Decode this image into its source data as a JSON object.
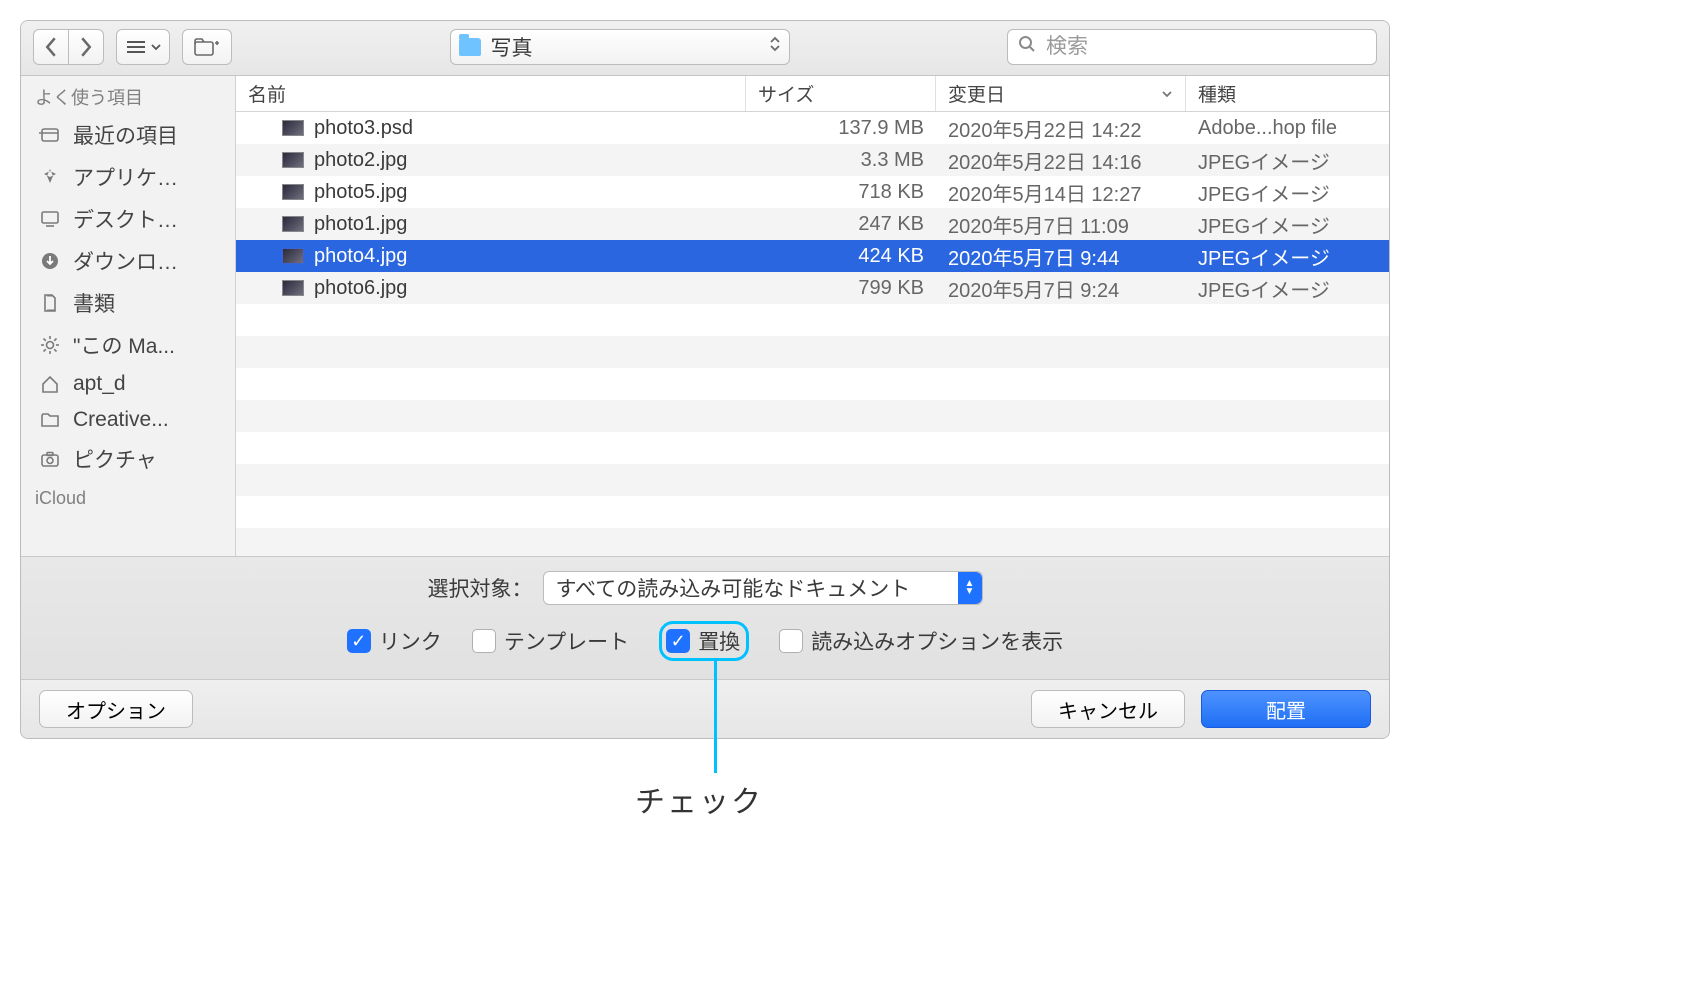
{
  "toolbar": {
    "location_label": "写真",
    "search_placeholder": "検索"
  },
  "sidebar": {
    "group1": "よく使う項目",
    "group2": "iCloud",
    "items": [
      {
        "icon": "recent",
        "label": "最近の項目"
      },
      {
        "icon": "apps",
        "label": "アプリケ…"
      },
      {
        "icon": "desktop",
        "label": "デスクト…"
      },
      {
        "icon": "download",
        "label": "ダウンロ…"
      },
      {
        "icon": "docs",
        "label": "書類"
      },
      {
        "icon": "gear",
        "label": "\"この Ma..."
      },
      {
        "icon": "home",
        "label": "apt_d"
      },
      {
        "icon": "folder",
        "label": "Creative..."
      },
      {
        "icon": "camera",
        "label": "ピクチャ"
      }
    ]
  },
  "columns": {
    "name": "名前",
    "size": "サイズ",
    "modified": "変更日",
    "kind": "種類"
  },
  "files": [
    {
      "name": "photo3.psd",
      "size": "137.9 MB",
      "date": "2020年5月22日 14:22",
      "kind": "Adobe...hop file",
      "selected": false
    },
    {
      "name": "photo2.jpg",
      "size": "3.3 MB",
      "date": "2020年5月22日 14:16",
      "kind": "JPEGイメージ",
      "selected": false
    },
    {
      "name": "photo5.jpg",
      "size": "718 KB",
      "date": "2020年5月14日 12:27",
      "kind": "JPEGイメージ",
      "selected": false
    },
    {
      "name": "photo1.jpg",
      "size": "247 KB",
      "date": "2020年5月7日 11:09",
      "kind": "JPEGイメージ",
      "selected": false
    },
    {
      "name": "photo4.jpg",
      "size": "424 KB",
      "date": "2020年5月7日 9:44",
      "kind": "JPEGイメージ",
      "selected": true
    },
    {
      "name": "photo6.jpg",
      "size": "799 KB",
      "date": "2020年5月7日 9:24",
      "kind": "JPEGイメージ",
      "selected": false
    }
  ],
  "enable": {
    "label": "選択対象：",
    "value": "すべての読み込み可能なドキュメント"
  },
  "checkboxes": {
    "link": {
      "label": "リンク",
      "checked": true
    },
    "template": {
      "label": "テンプレート",
      "checked": false
    },
    "replace": {
      "label": "置換",
      "checked": true
    },
    "show_opts": {
      "label": "読み込みオプションを表示",
      "checked": false
    }
  },
  "footer": {
    "options": "オプション",
    "cancel": "キャンセル",
    "place": "配置"
  },
  "annotation": "チェック"
}
